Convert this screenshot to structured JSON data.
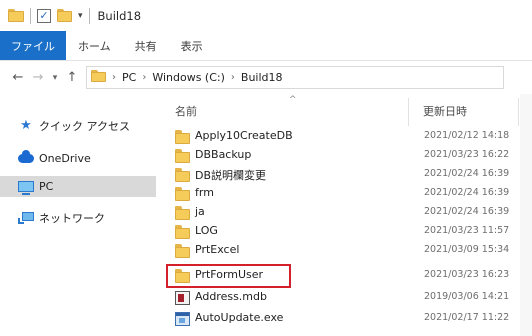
{
  "titlebar": {
    "title": "Build18"
  },
  "ribbon": {
    "tabs": [
      "ファイル",
      "ホーム",
      "共有",
      "表示"
    ]
  },
  "address": {
    "segments": [
      "PC",
      "Windows (C:)",
      "Build18"
    ]
  },
  "nav_pane": {
    "items": [
      {
        "label": "クイック アクセス",
        "icon": "star-icon"
      },
      {
        "label": "OneDrive",
        "icon": "cloud-icon"
      },
      {
        "label": "PC",
        "icon": "computer-icon",
        "selected": true
      },
      {
        "label": "ネットワーク",
        "icon": "network-icon"
      }
    ]
  },
  "columns": {
    "name": "名前",
    "date": "更新日時"
  },
  "files": [
    {
      "name": "Apply10CreateDB",
      "date": "2021/02/12 14:18",
      "type": "folder"
    },
    {
      "name": "DBBackup",
      "date": "2021/03/23 16:22",
      "type": "folder"
    },
    {
      "name": "DB説明欄変更",
      "date": "2021/02/24 16:39",
      "type": "folder"
    },
    {
      "name": "frm",
      "date": "2021/02/24 16:39",
      "type": "folder"
    },
    {
      "name": "ja",
      "date": "2021/02/24 16:39",
      "type": "folder"
    },
    {
      "name": "LOG",
      "date": "2021/03/23 11:57",
      "type": "folder"
    },
    {
      "name": "PrtExcel",
      "date": "2021/03/09 15:34",
      "type": "folder"
    },
    {
      "name": "PrtFormUser",
      "date": "2021/03/23 16:23",
      "type": "folder",
      "highlighted": true
    },
    {
      "name": "Address.mdb",
      "date": "2019/03/06 14:21",
      "type": "mdb"
    },
    {
      "name": "AutoUpdate.exe",
      "date": "2021/02/17 11:22",
      "type": "exe"
    }
  ],
  "colors": {
    "accent": "#1a6fc9",
    "highlight": "#d4202a",
    "folder": "#f5cc5a"
  }
}
